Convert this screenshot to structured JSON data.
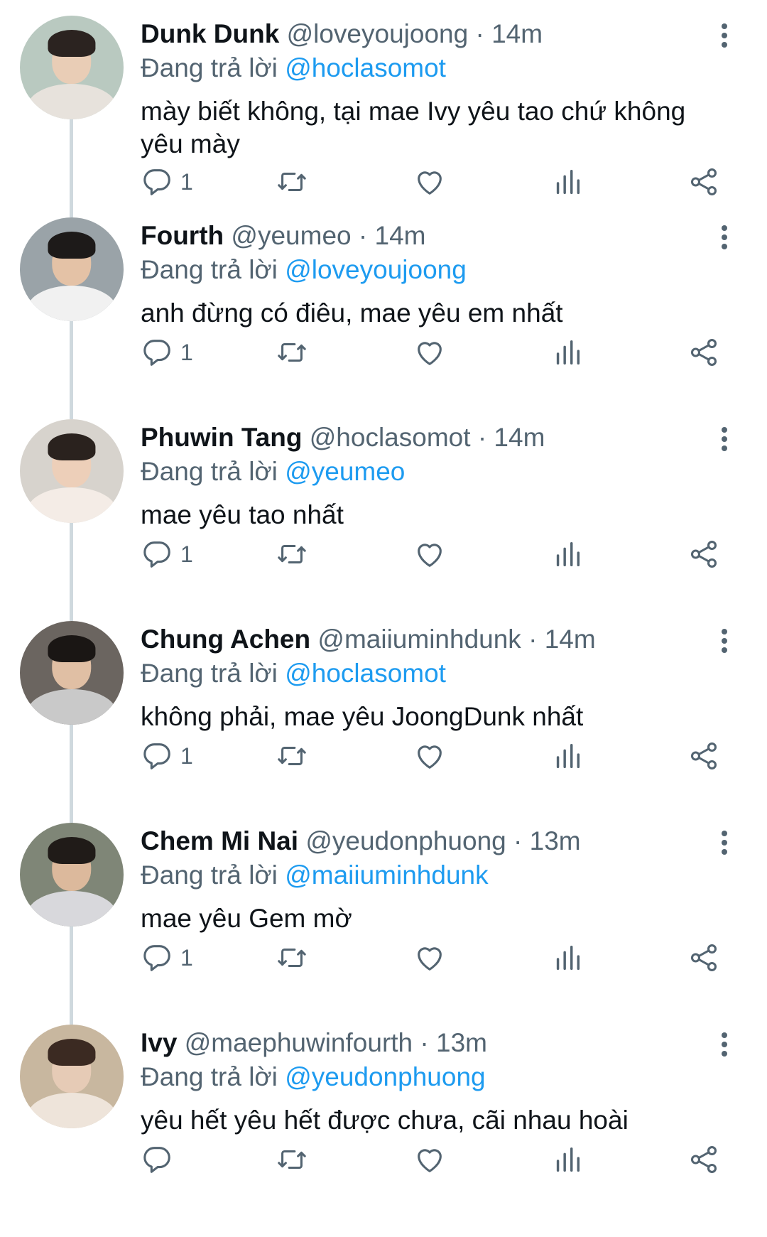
{
  "reply_prefix": "Đang trả lời",
  "tweets": [
    {
      "name": "Dunk Dunk",
      "handle": "@loveyoujoong",
      "time": "· 14m",
      "reply_to": "@hoclasomot",
      "text": "mày biết không, tại mae Ivy yêu tao chứ không yêu mày",
      "reply_count": "1",
      "avatar_colors": {
        "bg": "#b9c9c0",
        "face": "#e9cdb6",
        "hair": "#2b2320",
        "body": "#e7e2dc"
      }
    },
    {
      "name": "Fourth",
      "handle": "@yeumeo",
      "time": "· 14m",
      "reply_to": "@loveyoujoong",
      "text": "anh đừng có điêu, mae yêu em nhất",
      "reply_count": "1",
      "avatar_colors": {
        "bg": "#9aa3a8",
        "face": "#e4c2a6",
        "hair": "#1d1a19",
        "body": "#f1f1f1"
      }
    },
    {
      "name": "Phuwin Tang",
      "handle": "@hoclasomot",
      "time": "· 14m",
      "reply_to": "@yeumeo",
      "text": "mae yêu tao nhất",
      "reply_count": "1",
      "avatar_colors": {
        "bg": "#d7d3cd",
        "face": "#edcfb9",
        "hair": "#2a221e",
        "body": "#f4ece6"
      }
    },
    {
      "name": "Chung Achen",
      "handle": "@maiiuminhdunk",
      "time": "· 14m",
      "reply_to": "@hoclasomot",
      "text": "không phải, mae yêu JoongDunk nhất",
      "reply_count": "1",
      "avatar_colors": {
        "bg": "#6b6560",
        "face": "#e0bfa4",
        "hair": "#1a1614",
        "body": "#c9c9c9"
      }
    },
    {
      "name": "Chem Mi Nai",
      "handle": "@yeudonphuong",
      "time": "· 13m",
      "reply_to": "@maiiuminhdunk",
      "text": "mae yêu Gem mờ",
      "reply_count": "1",
      "avatar_colors": {
        "bg": "#7f8677",
        "face": "#dcb99c",
        "hair": "#201b18",
        "body": "#d8d8dc"
      }
    },
    {
      "name": "Ivy",
      "handle": "@maephuwinfourth",
      "time": "· 13m",
      "reply_to": "@yeudonphuong",
      "text": "yêu hết yêu hết được chưa, cãi nhau hoài",
      "reply_count": "",
      "avatar_colors": {
        "bg": "#c8b79f",
        "face": "#e6cbb6",
        "hair": "#3b2a22",
        "body": "#eee4da"
      }
    }
  ]
}
